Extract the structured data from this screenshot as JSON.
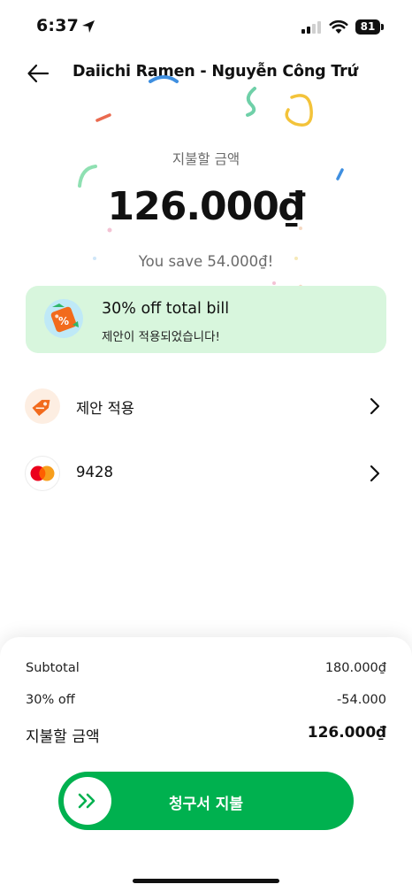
{
  "status_bar": {
    "time": "6:37",
    "battery": "81",
    "icons": [
      "location-arrow-icon",
      "signal-icon",
      "wifi-icon",
      "battery-icon"
    ]
  },
  "header": {
    "title": "Daiichi Ramen - Nguyễn Công Trứ",
    "back_icon": "arrow-left-icon"
  },
  "payment": {
    "amount_label": "지불할 금액",
    "amount": "126.000₫",
    "savings": "You save 54.000₫!"
  },
  "promo": {
    "title": "30% off total bill",
    "subtitle": "제안이 적용되었습니다!",
    "icon": "discount-tag-icon"
  },
  "rows": {
    "offer": {
      "label": "제안 적용",
      "icon": "tag-icon"
    },
    "card": {
      "label": "9428",
      "icon": "mastercard-icon"
    }
  },
  "summary": {
    "subtotal_label": "Subtotal",
    "subtotal_value": "180.000₫",
    "discount_label": "30% off",
    "discount_value": "-54.000",
    "total_label": "지불할 금액",
    "total_value": "126.000₫"
  },
  "pay_button": {
    "label": "청구서 지불"
  },
  "colors": {
    "brand_green": "#00b14f",
    "promo_bg": "#d8f6dd",
    "tag_orange": "#f26b1d"
  }
}
